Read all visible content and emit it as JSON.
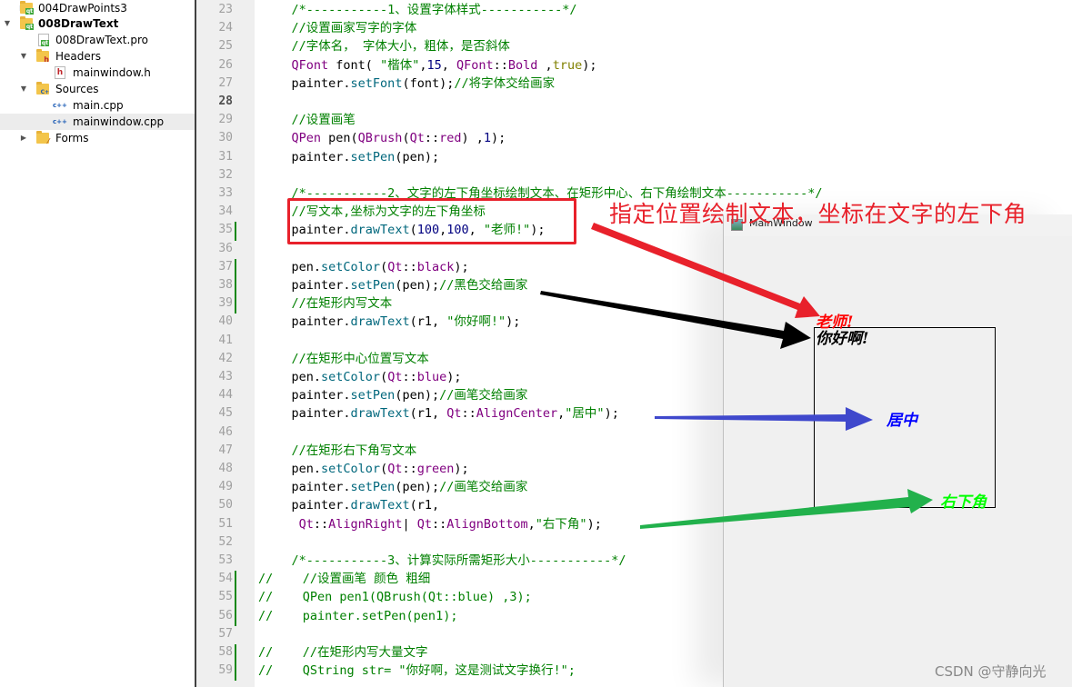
{
  "project_tree": {
    "items": [
      {
        "label": "004DrawPoints3",
        "type": "project",
        "expanded": false,
        "bold": false
      },
      {
        "label": "008DrawText",
        "type": "project",
        "expanded": true,
        "bold": true
      },
      {
        "label": "008DrawText.pro",
        "type": "pro-file"
      },
      {
        "label": "Headers",
        "type": "folder-headers",
        "expanded": true
      },
      {
        "label": "mainwindow.h",
        "type": "header-file"
      },
      {
        "label": "Sources",
        "type": "folder-sources",
        "expanded": true
      },
      {
        "label": "main.cpp",
        "type": "cpp-file"
      },
      {
        "label": "mainwindow.cpp",
        "type": "cpp-file",
        "selected": true
      },
      {
        "label": "Forms",
        "type": "folder-forms",
        "expanded": false
      }
    ]
  },
  "editor": {
    "current_line": 28,
    "lines": [
      {
        "n": "23",
        "text": "    /*-----------1、设置字体样式-----------*/"
      },
      {
        "n": "24",
        "text": "    //设置画家写字的字体"
      },
      {
        "n": "25",
        "text": "    //字体名， 字体大小，粗体，是否斜体"
      },
      {
        "n": "26",
        "text": "    QFont font( \"楷体\",15, QFont::Bold ,true);"
      },
      {
        "n": "27",
        "text": "    painter.setFont(font);//将字体交给画家"
      },
      {
        "n": "28",
        "text": ""
      },
      {
        "n": "29",
        "text": "    //设置画笔"
      },
      {
        "n": "30",
        "text": "    QPen pen(QBrush(Qt::red) ,1);"
      },
      {
        "n": "31",
        "text": "    painter.setPen(pen);"
      },
      {
        "n": "32",
        "text": ""
      },
      {
        "n": "33",
        "text": "    /*-----------2、文字的左下角坐标绘制文本、在矩形中心、右下角绘制文本-----------*/"
      },
      {
        "n": "34",
        "text": "    //写文本,坐标为文字的左下角坐标"
      },
      {
        "n": "35",
        "text": "    painter.drawText(100,100, \"老师!\");"
      },
      {
        "n": "36",
        "text": ""
      },
      {
        "n": "37",
        "text": "    pen.setColor(Qt::black);"
      },
      {
        "n": "38",
        "text": "    painter.setPen(pen);//黑色交给画家"
      },
      {
        "n": "39",
        "text": "    //在矩形内写文本"
      },
      {
        "n": "40",
        "text": "    painter.drawText(r1, \"你好啊!\");"
      },
      {
        "n": "41",
        "text": ""
      },
      {
        "n": "42",
        "text": "    //在矩形中心位置写文本"
      },
      {
        "n": "43",
        "text": "    pen.setColor(Qt::blue);"
      },
      {
        "n": "44",
        "text": "    painter.setPen(pen);//画笔交给画家"
      },
      {
        "n": "45",
        "text": "    painter.drawText(r1, Qt::AlignCenter,\"居中\");"
      },
      {
        "n": "46",
        "text": ""
      },
      {
        "n": "47",
        "text": "    //在矩形右下角写文本"
      },
      {
        "n": "48",
        "text": "    pen.setColor(Qt::green);"
      },
      {
        "n": "49",
        "text": "    painter.setPen(pen);//画笔交给画家"
      },
      {
        "n": "50",
        "text": "    painter.drawText(r1,"
      },
      {
        "n": "51",
        "text": "     Qt::AlignRight| Qt::AlignBottom,\"右下角\");"
      },
      {
        "n": "52",
        "text": ""
      },
      {
        "n": "53",
        "text": "    /*-----------3、计算实际所需矩形大小-----------*/"
      },
      {
        "n": "54",
        "text": "//    //设置画笔 颜色 粗细"
      },
      {
        "n": "55",
        "text": "//    QPen pen1(QBrush(Qt::blue) ,3);"
      },
      {
        "n": "56",
        "text": "//    painter.setPen(pen1);"
      },
      {
        "n": "57",
        "text": ""
      },
      {
        "n": "58",
        "text": "//    //在矩形内写大量文字"
      },
      {
        "n": "59",
        "text": "//    QString str= \"你好啊，这是测试文字换行!\";"
      }
    ],
    "changed_lines": [
      "35",
      "37",
      "38",
      "39",
      "54",
      "55",
      "56",
      "58",
      "59"
    ]
  },
  "qt_window": {
    "title": "MainWindow",
    "texts": {
      "teacher": "老师!",
      "hello": "你好啊!",
      "center": "居中",
      "bottom_right": "右下角"
    },
    "colors": {
      "teacher": "#ff0000",
      "hello": "#000000",
      "center": "#0000ff",
      "bottom_right": "#00ff00"
    }
  },
  "annotation": {
    "text": "指定位置绘制文本，坐标在文字的左下角",
    "color": "#e8212b",
    "arrow_colors": {
      "red": "#e8212b",
      "black": "#000000",
      "blue": "#3f48cc",
      "green": "#22b14c"
    }
  },
  "watermark": "CSDN @守静向光"
}
